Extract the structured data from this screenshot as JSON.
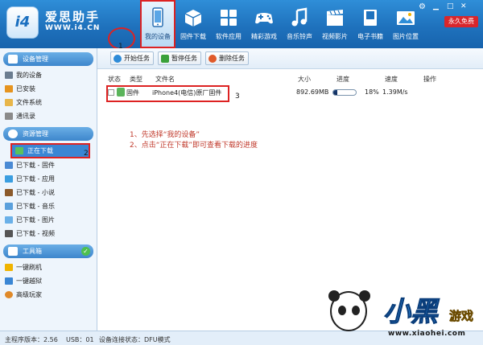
{
  "app": {
    "logo_text": "i4",
    "name": "爱思助手",
    "url": "WWW.i4.CN",
    "vip_label": "永久免费",
    "window_controls": [
      "gear-icon",
      "minimize-icon",
      "maximize-icon",
      "close-icon"
    ]
  },
  "nav": {
    "items": [
      {
        "label": "我的设备",
        "icon": "phone-icon",
        "active": true
      },
      {
        "label": "固件下载",
        "icon": "box-icon"
      },
      {
        "label": "软件应用",
        "icon": "apps-grid-icon"
      },
      {
        "label": "精彩游戏",
        "icon": "gamepad-icon"
      },
      {
        "label": "音乐铃声",
        "icon": "music-note-icon"
      },
      {
        "label": "视频影片",
        "icon": "clapperboard-icon"
      },
      {
        "label": "电子书籍",
        "icon": "book-icon"
      },
      {
        "label": "图片位置",
        "icon": "picture-icon"
      }
    ]
  },
  "sidebar": {
    "sections": [
      {
        "title": "设备管理",
        "items": [
          "我的设备",
          "已安装",
          "文件系统",
          "通讯录"
        ]
      },
      {
        "title": "资源管理",
        "items": [
          "正在下载",
          "已下载 - 固件",
          "已下载 - 应用",
          "已下载 - 小说",
          "已下载 - 音乐",
          "已下载 - 图片",
          "已下载 - 视频"
        ]
      },
      {
        "title": "工具箱",
        "items": [
          "一键刷机",
          "一键越狱",
          "高级玩家"
        ]
      }
    ]
  },
  "toolbar": {
    "start_label": "开始任务",
    "pause_label": "暂停任务",
    "delete_label": "删除任务"
  },
  "table": {
    "headers": [
      "状态",
      "类型",
      "文件名",
      "大小",
      "进度",
      "速度",
      "操作"
    ],
    "rows": [
      {
        "type": "固件",
        "filename": "iPhone4(电信)原厂固件",
        "size": "892.69MB",
        "progress_percent": 18,
        "progress_label": "18%",
        "speed": "1.39M/s"
      }
    ]
  },
  "annotations": {
    "marker_1": "1",
    "marker_2": "2",
    "marker_3": "3",
    "instruction_1": "1、先选择“我的设备”",
    "instruction_2": "2、点击“正在下载”即可查看下载的进度"
  },
  "statusbar": {
    "version": "主程序版本：2.56",
    "usb": "USB：01",
    "device_status": "设备连接状态：DFU模式"
  },
  "watermark": {
    "logo": "小黑",
    "game": "游戏",
    "url": "www.xiaohei.com"
  },
  "colors": {
    "header_blue": "#1f72bd",
    "annotation_red": "#d22222",
    "instruction_red": "#c0392b",
    "selected_blue": "#3a86d4"
  }
}
